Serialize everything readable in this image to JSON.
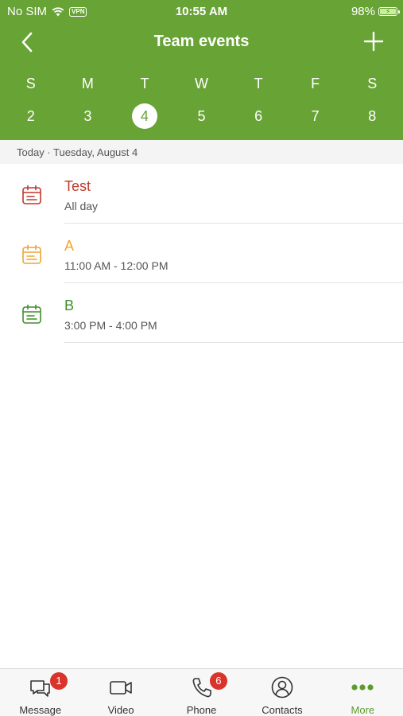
{
  "status_bar": {
    "carrier": "No SIM",
    "vpn": "VPN",
    "time": "10:55 AM",
    "battery": "98%",
    "battery_level": 0.98
  },
  "nav": {
    "title": "Team events",
    "back_icon": "chevron-left-icon",
    "add_icon": "plus-icon"
  },
  "week": {
    "days": [
      "S",
      "M",
      "T",
      "W",
      "T",
      "F",
      "S"
    ],
    "dates": [
      "2",
      "3",
      "4",
      "5",
      "6",
      "7",
      "8"
    ],
    "selected_index": 2
  },
  "date_label": "Today · Tuesday, August 4",
  "events": [
    {
      "title": "Test",
      "time": "All day",
      "color": "#c0392b",
      "icon": "calendar-icon"
    },
    {
      "title": "A",
      "time": "11:00 AM - 12:00 PM",
      "color": "#f0a431",
      "icon": "calendar-icon"
    },
    {
      "title": "B",
      "time": "3:00 PM - 4:00 PM",
      "color": "#3f8f2a",
      "icon": "calendar-icon"
    }
  ],
  "tabs": [
    {
      "label": "Message",
      "icon": "chat-bubbles-icon",
      "badge": "1"
    },
    {
      "label": "Video",
      "icon": "video-camera-icon",
      "badge": ""
    },
    {
      "label": "Phone",
      "icon": "phone-icon",
      "badge": "6"
    },
    {
      "label": "Contacts",
      "icon": "contact-person-icon",
      "badge": ""
    },
    {
      "label": "More",
      "icon": "more-dots-icon",
      "badge": ""
    }
  ],
  "colors": {
    "header_green": "#68a336",
    "active_tab": "#5d9b2e",
    "badge_red": "#d9342b"
  }
}
